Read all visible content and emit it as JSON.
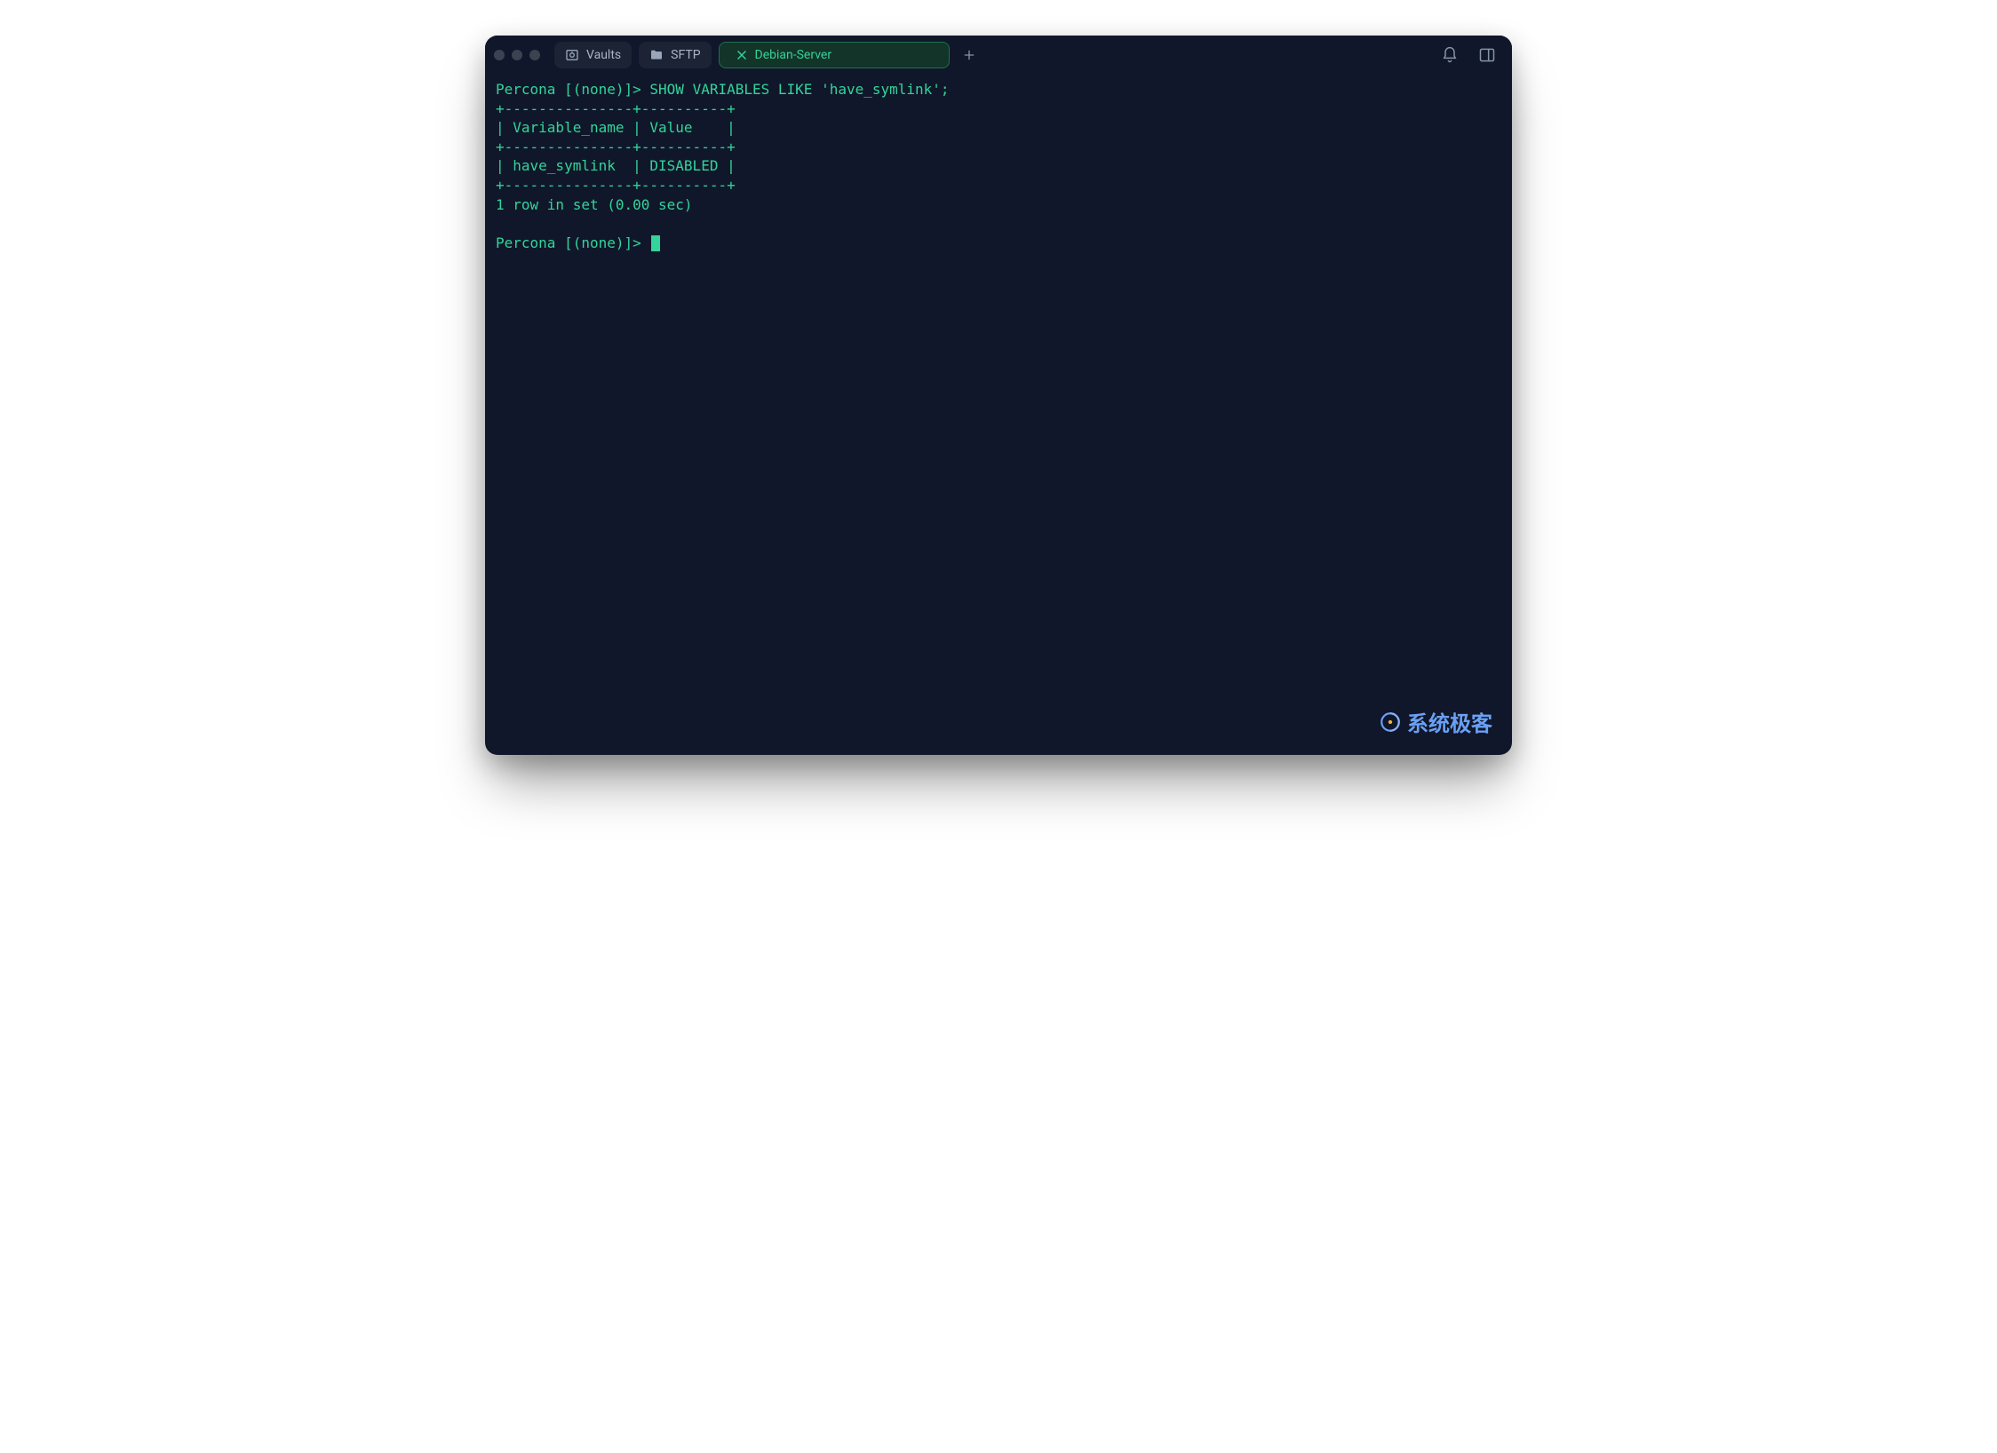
{
  "tabs": {
    "vaults": {
      "label": "Vaults"
    },
    "sftp": {
      "label": "SFTP"
    },
    "active": {
      "label": "Debian-Server"
    }
  },
  "terminal": {
    "prompt": "Percona [(none)]>",
    "command": "SHOW VARIABLES LIKE 'have_symlink';",
    "border": "+---------------+----------+",
    "header": "| Variable_name | Value    |",
    "row": "| have_symlink  | DISABLED |",
    "summary": "1 row in set (0.00 sec)"
  },
  "watermark": {
    "text": "系统极客"
  }
}
